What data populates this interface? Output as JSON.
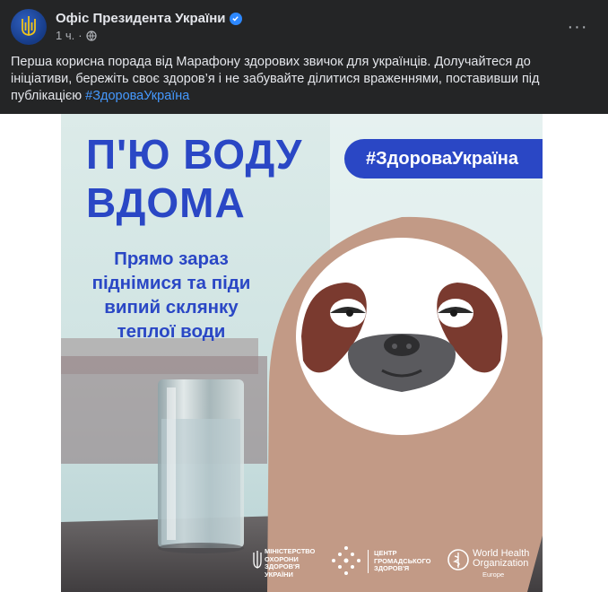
{
  "post": {
    "author": "Офіс Президента України",
    "time": "1 ч.",
    "separator": "·",
    "more_label": "···",
    "text_main": "Перша корисна порада від Марафону здорових звичок для українців. Долучайтеся до ініціативи, бережіть своє здоров’я і не забувайте ділитися враженнями, поставивши під публікацією ",
    "hashtag": "#ЗдороваУкраїна"
  },
  "graphic": {
    "title_line1": "П'Ю ВОДУ",
    "title_line2": "ВДОМА",
    "tag": "#ЗдороваУкраїна",
    "sub_line1": "Прямо зараз",
    "sub_line2": "піднімися та піди",
    "sub_line3": "випий склянку",
    "sub_line4": "теплої води",
    "logo_moz_1": "Міністерство",
    "logo_moz_2": "охорони",
    "logo_moz_3": "здоров'я",
    "logo_moz_4": "України",
    "logo_center_1": "Центр",
    "logo_center_2": "громадського",
    "logo_center_3": "здоров'я",
    "logo_who_1": "World Health",
    "logo_who_2": "Organization",
    "logo_who_3": "Europe"
  },
  "colors": {
    "accent_blue": "#2a47c5",
    "link": "#4599ff",
    "bg_dark": "#242526"
  }
}
